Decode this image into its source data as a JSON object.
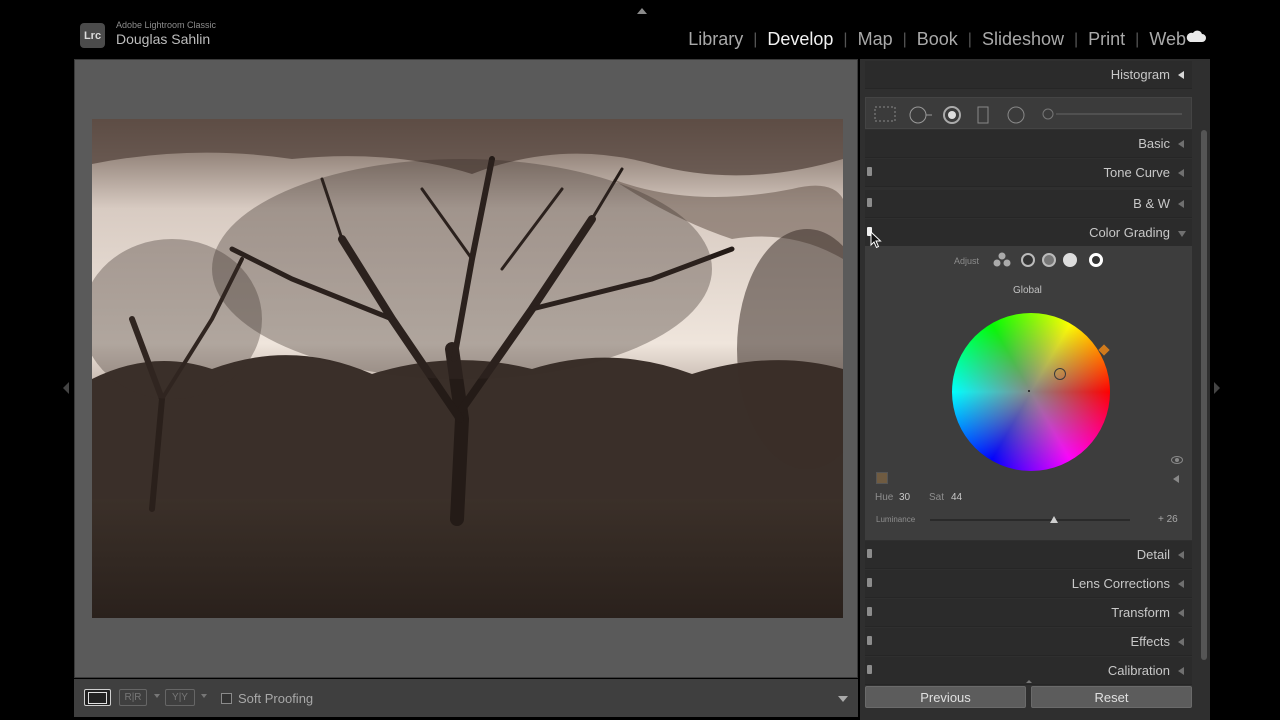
{
  "app": {
    "product": "Adobe Lightroom Classic",
    "user": "Douglas Sahlin",
    "logo_text": "Lrc"
  },
  "modules": {
    "items": [
      "Library",
      "Develop",
      "Map",
      "Book",
      "Slideshow",
      "Print",
      "Web"
    ],
    "active": "Develop"
  },
  "panels": {
    "histogram": "Histogram",
    "basic": "Basic",
    "tone_curve": "Tone Curve",
    "bw": "B & W",
    "color_grading": "Color Grading",
    "detail": "Detail",
    "lens_corrections": "Lens Corrections",
    "transform": "Transform",
    "effects": "Effects",
    "calibration": "Calibration"
  },
  "color_grading": {
    "adjust_label": "Adjust",
    "mode_label": "Global",
    "hue_label": "Hue",
    "hue_value": "30",
    "sat_label": "Sat",
    "sat_value": "44",
    "luminance_label": "Luminance",
    "luminance_value": "+ 26",
    "swatch_color": "#6f5b41"
  },
  "toolbar": {
    "compare_rr": "R|R",
    "compare_yy": "Y|Y",
    "soft_proofing": "Soft Proofing"
  },
  "buttons": {
    "previous": "Previous",
    "reset": "Reset"
  },
  "colors": {
    "panel_bg": "#2f2f2f",
    "workspace_bg": "#5a5a5a",
    "active_module": "#f2f2f2"
  }
}
